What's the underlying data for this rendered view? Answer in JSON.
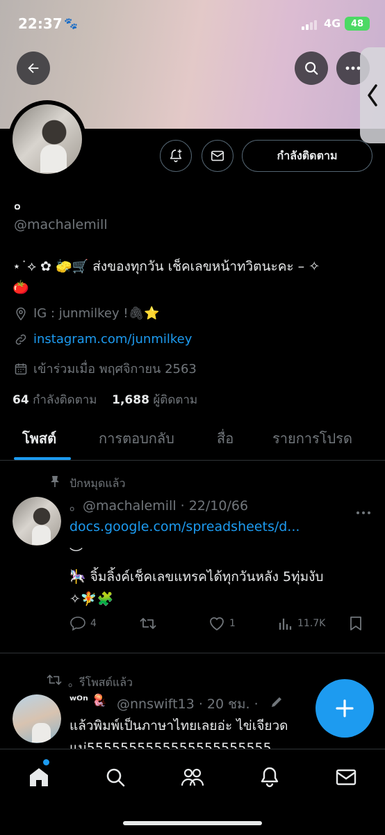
{
  "status": {
    "time": "22:37",
    "network": "4G",
    "battery": "48"
  },
  "profile": {
    "name": "๐",
    "handle": "@machalemill",
    "bio_line1": "⋆˙⟡ ✿ 🧽🛒 ส่งของทุกวัน เช็คเลขหน้าทวิตนะคะ – ✧",
    "bio_line2": "🍅",
    "ig": "IG : junmilkey  !🖇⭐",
    "link": "instagram.com/junmilkey",
    "joined": "เข้าร่วมเมื่อ พฤศจิกายน 2563",
    "following_count": "64",
    "following_label": "กำลังติดตาม",
    "followers_count": "1,688",
    "followers_label": "ผู้ติดตาม",
    "following_button": "กำลังติดตาม"
  },
  "tabs": [
    "โพสต์",
    "การตอบกลับ",
    "สื่อ",
    "รายการโปรด"
  ],
  "pinned_post": {
    "context": "ปักหมุดแล้ว",
    "handle_line": "。@machalemill · 22/10/66",
    "link": "docs.google.com/spreadsheets/d...",
    "deco": "︶",
    "line1": "🎠 จิ้มลิ้งค์เช็คเลขแทรคได้ทุกวันหลัง 5ทุ่มงับ",
    "line2": "✧🧚🧩",
    "replies": "4",
    "likes": "1",
    "views": "11.7K"
  },
  "repost": {
    "context": "。รีโพสต์แล้ว",
    "name": "ʷᴼⁿ 🪼",
    "handle_line": "@nnswift13 · 20 ชม. ·",
    "line1": "แล้วพิมพ์เป็นภาษาไทยเลยอ่ะ ไข่เจียวด",
    "line2": "แม่5555555555555555555555"
  },
  "colors": {
    "accent": "#1d9bf0",
    "background": "#000000",
    "muted": "#71767b"
  }
}
